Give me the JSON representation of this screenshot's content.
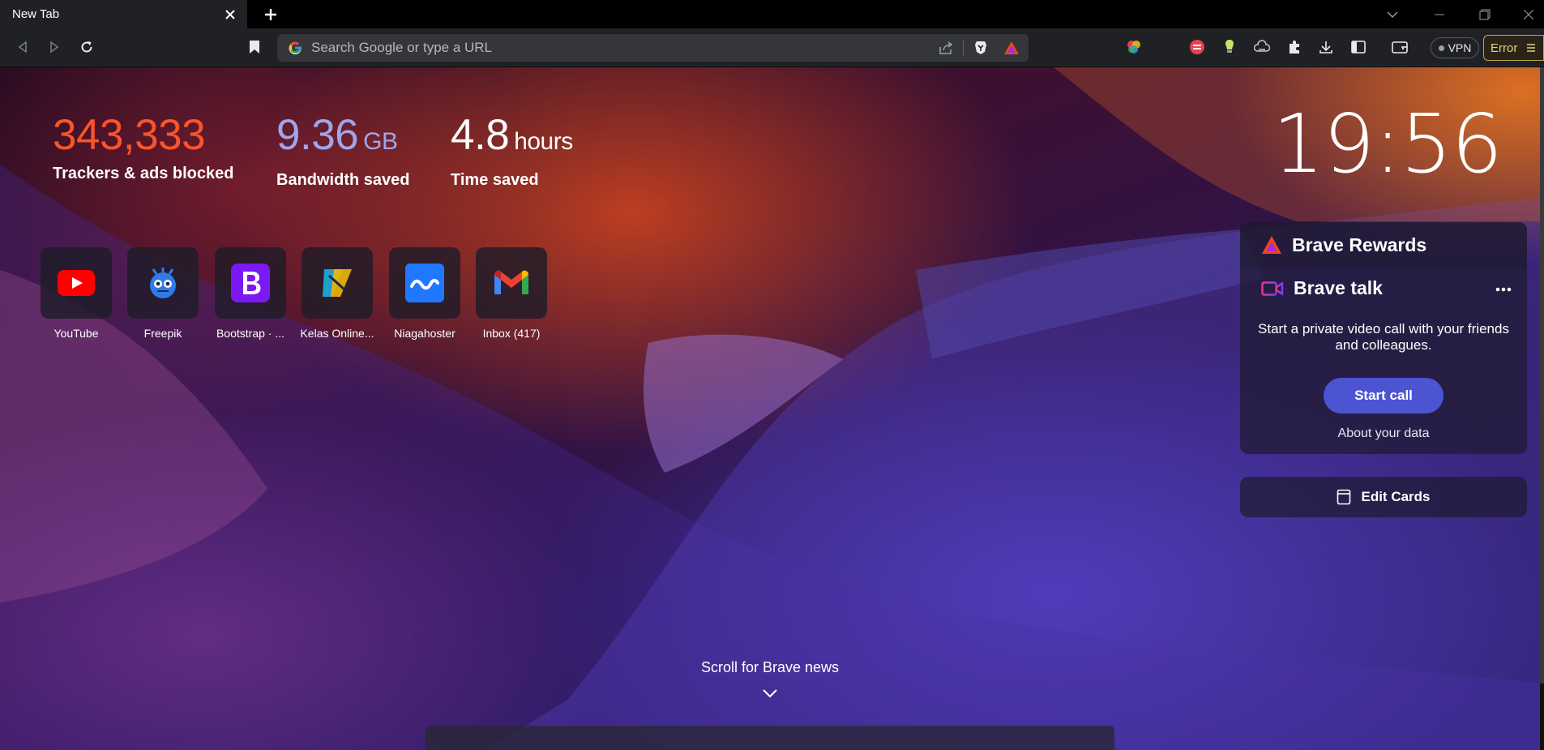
{
  "tab": {
    "title": "New Tab"
  },
  "omnibox": {
    "placeholder": "Search Google or type a URL"
  },
  "toolbar": {
    "vpn_label": "VPN",
    "error_label": "Error"
  },
  "stats": [
    {
      "value": "343,333",
      "unit": "",
      "label": "Trackers & ads blocked",
      "color": "#fb542b"
    },
    {
      "value": "9.36",
      "unit": "GB",
      "label": "Bandwidth saved",
      "color": "#a0a5eb"
    },
    {
      "value": "4.8",
      "unit": "hours",
      "label": "Time saved",
      "color": "#ffffff"
    }
  ],
  "top_sites": [
    {
      "label": "YouTube",
      "icon": "youtube-icon"
    },
    {
      "label": "Freepik",
      "icon": "freepik-icon"
    },
    {
      "label": "Bootstrap · ...",
      "icon": "bootstrap-icon"
    },
    {
      "label": "Kelas Online...",
      "icon": "kelas-online-icon"
    },
    {
      "label": "Niagahoster",
      "icon": "niagahoster-icon"
    },
    {
      "label": "Inbox (417)",
      "icon": "gmail-icon"
    }
  ],
  "clock": {
    "time": "19:56"
  },
  "rewards": {
    "title": "Brave Rewards"
  },
  "talk": {
    "title": "Brave talk",
    "description": "Start a private video call with your friends and colleagues.",
    "start_button": "Start call",
    "about_link": "About your data"
  },
  "edit_cards": {
    "label": "Edit Cards"
  },
  "news": {
    "scroll_label": "Scroll for Brave news"
  },
  "colors": {
    "brand_orange": "#fb542b",
    "talk_button": "#4c54d2",
    "error_border": "#c5a24a"
  }
}
